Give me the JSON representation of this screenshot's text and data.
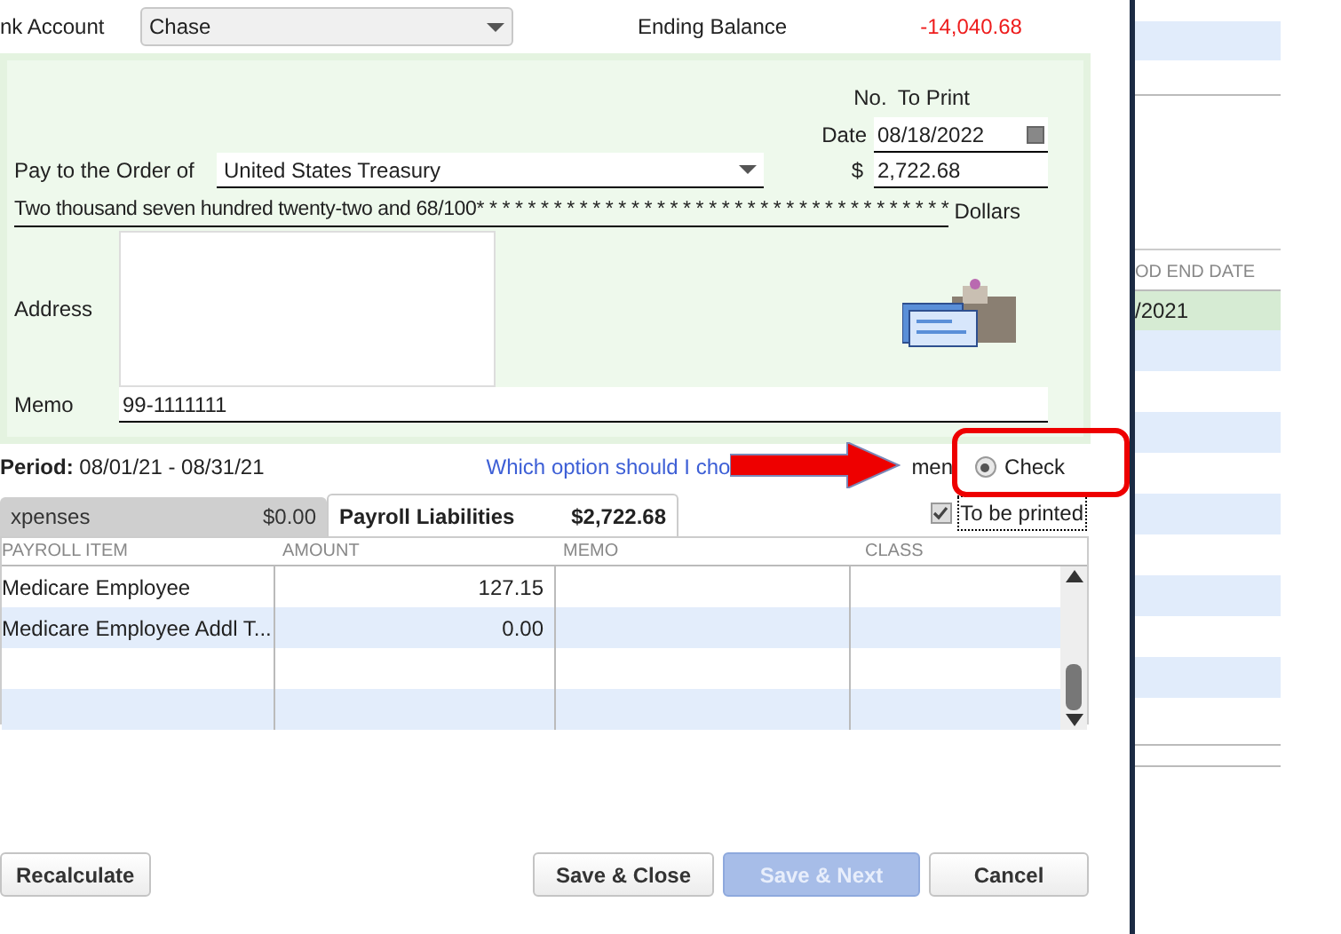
{
  "bank_account": {
    "label": "nk Account",
    "value": "Chase"
  },
  "ending_balance": {
    "label": "Ending Balance",
    "value": "-14,040.68"
  },
  "check": {
    "no_label": "No.",
    "no_value": "To Print",
    "date_label": "Date",
    "date": "08/18/2022",
    "payee_label": "Pay to the Order of",
    "payee": "United States Treasury",
    "amount_label": "$",
    "amount": "2,722.68",
    "amount_words": "Two thousand seven hundred twenty-two and 68/100* * * * * * * * * * * * * * * * * * * * * * * * * * * * * * * * * * * * *",
    "dollars_label": "Dollars",
    "address_label": "Address",
    "memo_label": "Memo",
    "memo": "99-1111111"
  },
  "period": "**Period:** 08/01/21 - 08/31/21",
  "help_link": "Which option should I cho",
  "hidden_option_fragment": "men",
  "payment_options": [
    {
      "label": "Check",
      "selected": true
    }
  ],
  "to_be_printed": {
    "label": "To be printed",
    "checked": true
  },
  "tabs": [
    {
      "label": "xpenses",
      "amount": "$0.00",
      "selected": false
    },
    {
      "label": "Payroll Liabilities",
      "amount": "$2,722.68",
      "selected": true
    }
  ],
  "table": {
    "columns": [
      "PAYROLL ITEM",
      "AMOUNT",
      "MEMO",
      "CLASS"
    ],
    "rows": [
      [
        "Medicare Employee",
        "127.15",
        "",
        ""
      ],
      [
        "Medicare Employee Addl T...",
        "0.00",
        "",
        ""
      ],
      [
        "",
        "",
        "",
        ""
      ],
      [
        "",
        "",
        "",
        ""
      ]
    ]
  },
  "buttons": [
    {
      "label": "Recalculate",
      "disabled": false
    },
    {
      "label": "Save & Close",
      "disabled": false
    },
    {
      "label": "Save & Next",
      "disabled": true
    },
    {
      "label": "Cancel",
      "disabled": false
    }
  ],
  "side_panel": {
    "header": "OD END DATE",
    "cell": "/2021"
  }
}
